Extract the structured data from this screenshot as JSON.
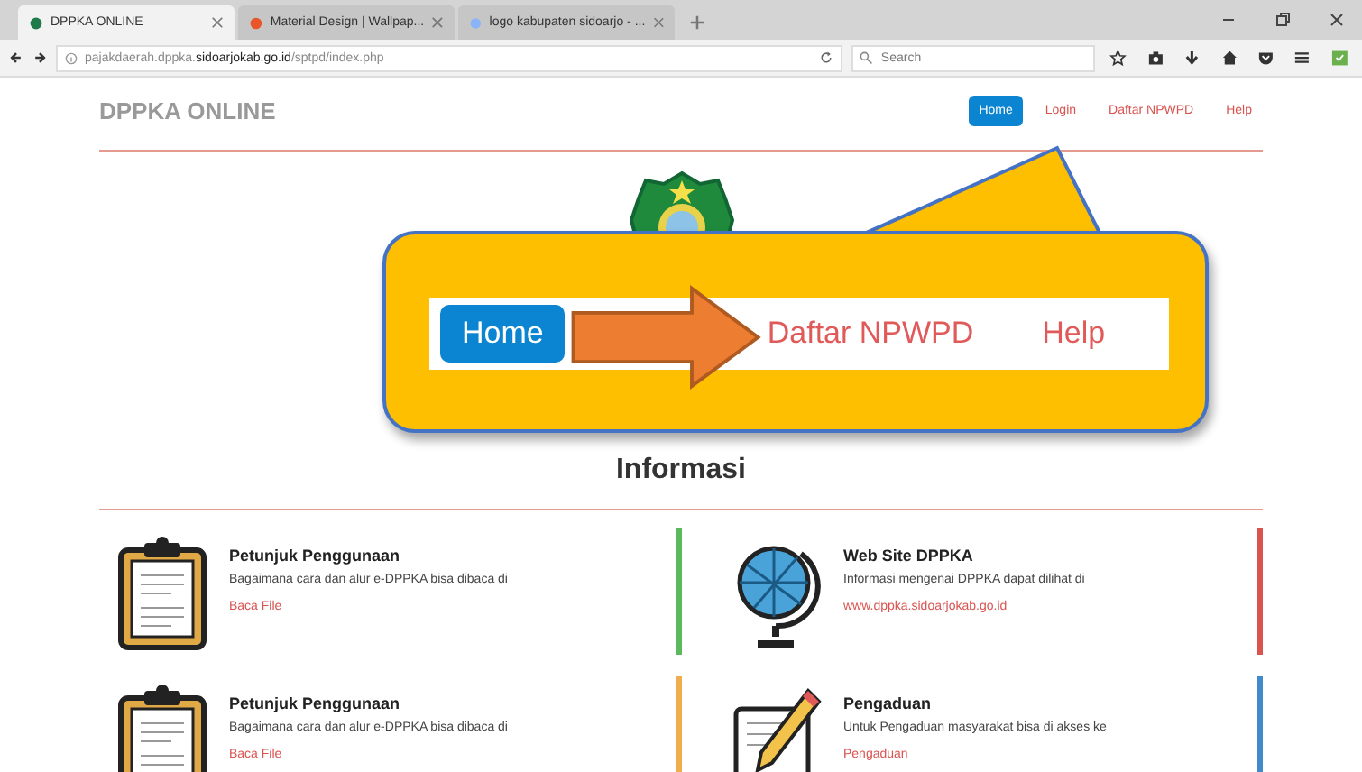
{
  "browser": {
    "tabs": [
      {
        "title": "DPPKA ONLINE",
        "selected": true
      },
      {
        "title": "Material Design | Wallpap...",
        "selected": false
      },
      {
        "title": "logo kabupaten sidoarjo - ...",
        "selected": false
      }
    ],
    "url": "pajakdaerah.dppka.**sidoarjokab.go.id**/sptpd/index.php",
    "search": {
      "placeholder": "Search"
    }
  },
  "page": {
    "brand": "DPPKA ONLINE",
    "nav": [
      {
        "label": "Home",
        "selected": true
      },
      {
        "label": "Login",
        "selected": false
      },
      {
        "label": "Daftar NPWPD",
        "selected": false
      },
      {
        "label": "Help",
        "selected": false
      }
    ],
    "callout": {
      "nav": [
        {
          "label": "Home",
          "selected": true
        },
        {
          "label": "Daftar NPWPD",
          "selected": false
        },
        {
          "label": "Help",
          "selected": false
        }
      ]
    },
    "section_title": "Informasi",
    "cards": [
      {
        "kind": "clipboard",
        "title": "Petunjuk Penggunaan",
        "text": "Bagaimana cara dan alur e-DPPKA bisa dibaca di",
        "link": "Baca File",
        "color": "#5cb85c"
      },
      {
        "kind": "globe",
        "title": "Web Site DPPKA",
        "text": "Informasi mengenai DPPKA dapat dilihat di",
        "link": "www.dppka.sidoarjokab.go.id",
        "color": "#d9534f"
      },
      {
        "kind": "clipboard",
        "title": "Petunjuk Penggunaan",
        "text": "Bagaimana cara dan alur e-DPPKA bisa dibaca di",
        "link": "Baca File",
        "color": "#f0ad4e"
      },
      {
        "kind": "pencil",
        "title": "Pengaduan",
        "text": "Untuk Pengaduan masyarakat bisa di akses ke",
        "link": "Pengaduan",
        "color": "#428bca"
      }
    ]
  }
}
